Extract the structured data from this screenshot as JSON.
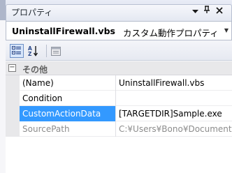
{
  "window": {
    "title": "プロパティ",
    "icons": {
      "dropdown": "dropdown-arrow-icon",
      "pin": "pin-icon",
      "close": "close-icon"
    }
  },
  "object_selector": {
    "name": "UninstallFirewall.vbs",
    "type": "カスタム動作プロパティ"
  },
  "toolbar": {
    "buttons": [
      {
        "icon": "categorized-icon",
        "active": true
      },
      {
        "icon": "alphabetical-sort-icon",
        "active": false
      },
      {
        "icon": "property-pages-icon",
        "active": false
      }
    ]
  },
  "grid": {
    "category": {
      "toggle": "⊟",
      "label": "その他"
    },
    "rows": [
      {
        "name": "(Name)",
        "value": "UninstallFirewall.vbs"
      },
      {
        "name": "Condition",
        "value": ""
      },
      {
        "name": "CustomActionData",
        "value": "[TARGETDIR]Sample.exe"
      },
      {
        "name": "SourcePath",
        "value": "C:¥Users¥Bono¥Documents"
      }
    ]
  },
  "colors": {
    "selection": "#3399ff",
    "readonly_text": "#8c8c8c"
  }
}
